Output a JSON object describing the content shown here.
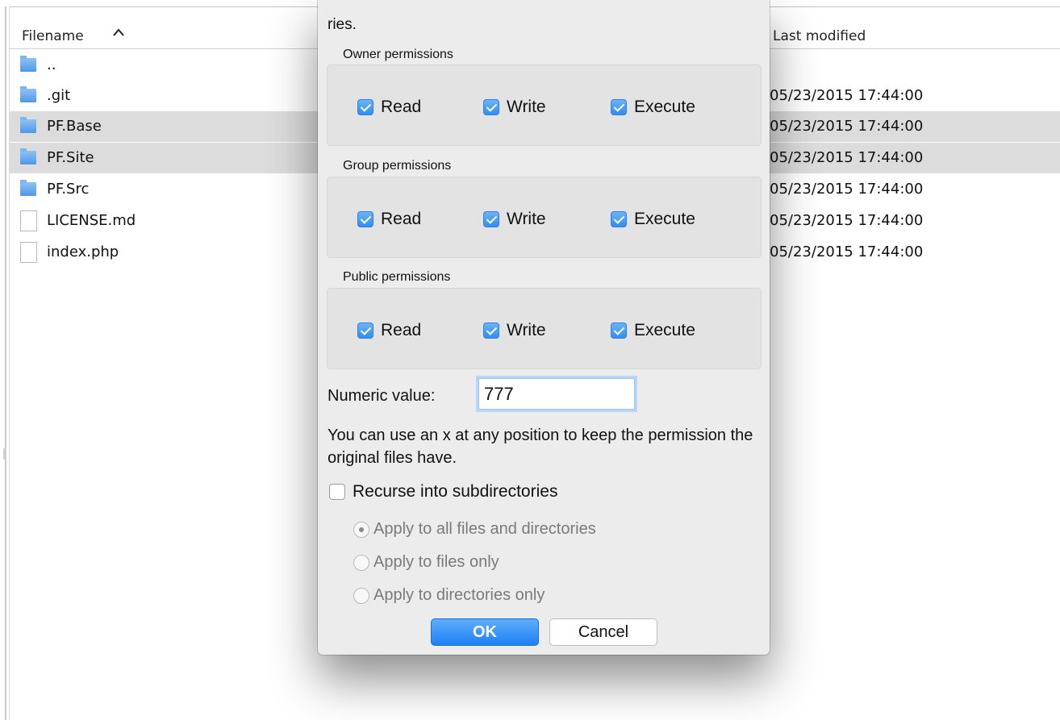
{
  "file_list": {
    "columns": {
      "filename": "Filename",
      "last_modified": "Last modified",
      "sort_indicator": "^"
    },
    "rows": [
      {
        "name": "..",
        "type": "folder",
        "modified": "",
        "selected": false
      },
      {
        "name": ".git",
        "type": "folder",
        "modified": "05/23/2015 17:44:00",
        "selected": false
      },
      {
        "name": "PF.Base",
        "type": "folder",
        "modified": "05/23/2015 17:44:00",
        "selected": true
      },
      {
        "name": "PF.Site",
        "type": "folder",
        "modified": "05/23/2015 17:44:00",
        "selected": true
      },
      {
        "name": "PF.Src",
        "type": "folder",
        "modified": "05/23/2015 17:44:00",
        "selected": false
      },
      {
        "name": "LICENSE.md",
        "type": "file",
        "modified": "05/23/2015 17:44:00",
        "selected": false
      },
      {
        "name": "index.php",
        "type": "file",
        "modified": "05/23/2015 17:44:00",
        "selected": false
      }
    ]
  },
  "dialog": {
    "top_text": "ries.",
    "groups": [
      {
        "title": "Owner permissions",
        "read": "Read",
        "write": "Write",
        "execute": "Execute",
        "read_checked": true,
        "write_checked": true,
        "execute_checked": true
      },
      {
        "title": "Group permissions",
        "read": "Read",
        "write": "Write",
        "execute": "Execute",
        "read_checked": true,
        "write_checked": true,
        "execute_checked": true
      },
      {
        "title": "Public permissions",
        "read": "Read",
        "write": "Write",
        "execute": "Execute",
        "read_checked": true,
        "write_checked": true,
        "execute_checked": true
      }
    ],
    "numeric_label": "Numeric value:",
    "numeric_value": "777",
    "hint": "You can use an x at any position to keep the permission the original files have.",
    "recurse_label": "Recurse into subdirectories",
    "recurse_checked": false,
    "apply_options": [
      {
        "label": "Apply to all files and directories",
        "selected": true
      },
      {
        "label": "Apply to files only",
        "selected": false
      },
      {
        "label": "Apply to directories only",
        "selected": false
      }
    ],
    "ok_label": "OK",
    "cancel_label": "Cancel"
  },
  "colors": {
    "accent": "#2f8ef5",
    "selected_row": "#dcdcdc",
    "dialog_bg": "#ececec"
  }
}
